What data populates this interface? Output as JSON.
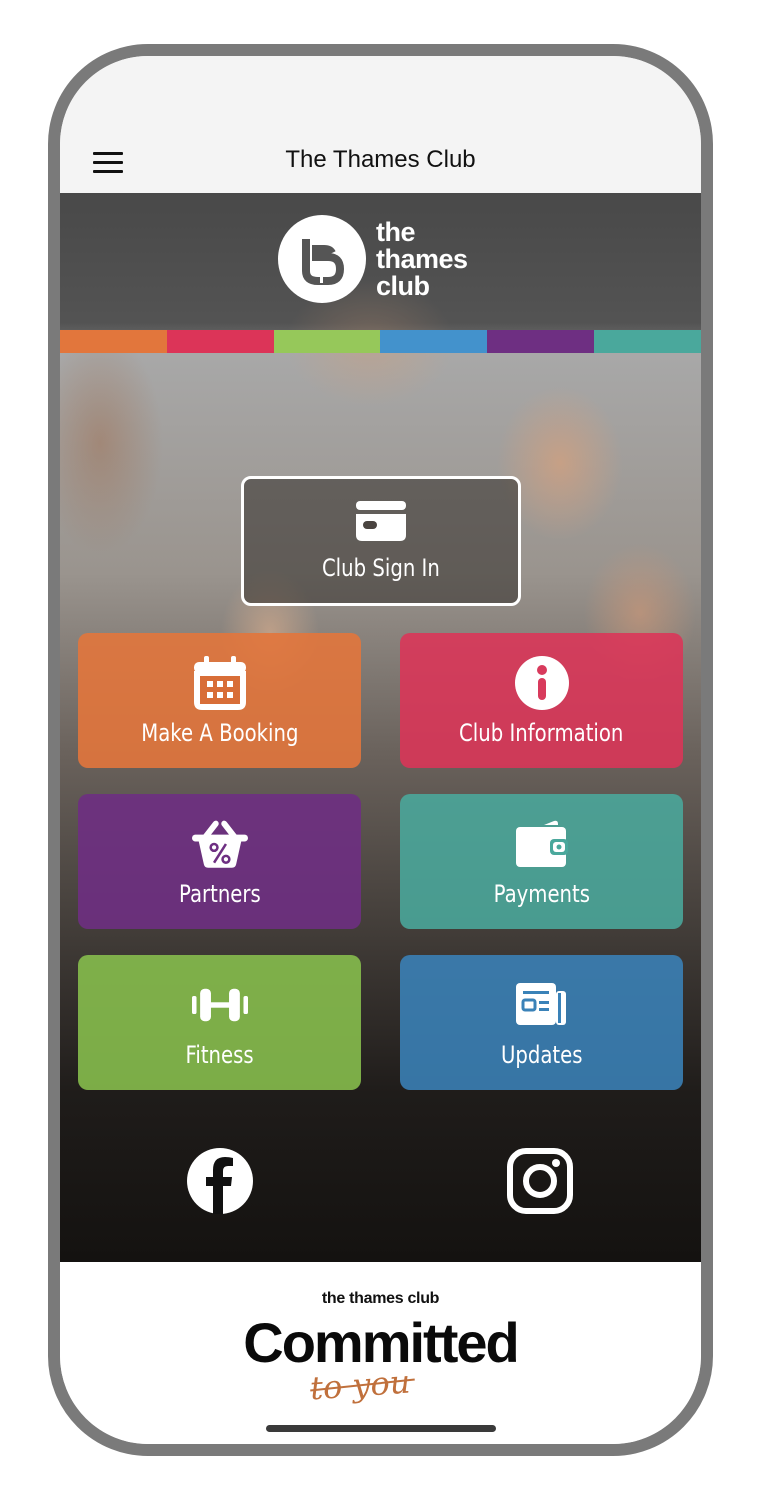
{
  "header": {
    "title": "The Thames Club",
    "menu_icon": "hamburger-icon"
  },
  "hero": {
    "logo": {
      "icon": "thames-club-logo-icon",
      "line1": "the",
      "line2": "thames",
      "line3": "club"
    },
    "brand_colors": [
      "#e2763c",
      "#dc3458",
      "#96c85a",
      "#4392cc",
      "#6e2f82",
      "#4aa89c"
    ]
  },
  "sign_in": {
    "label": "Club Sign In",
    "icon": "card-icon"
  },
  "tiles": [
    {
      "label": "Make A Booking",
      "icon": "calendar-icon",
      "color": "#e2763c"
    },
    {
      "label": "Club Information",
      "icon": "info-icon",
      "color": "#dc3458"
    },
    {
      "label": "Partners",
      "icon": "basket-percent-icon",
      "color": "#6e2f82"
    },
    {
      "label": "Payments",
      "icon": "wallet-icon",
      "color": "#4aa89c"
    },
    {
      "label": "Fitness",
      "icon": "dumbbell-icon",
      "color": "#86bc4c"
    },
    {
      "label": "Updates",
      "icon": "newspaper-icon",
      "color": "#3a82b8"
    }
  ],
  "social": {
    "facebook_icon": "facebook-icon",
    "instagram_icon": "instagram-icon"
  },
  "footer": {
    "small": "the thames club",
    "big": "Committed",
    "script": "to you",
    "script_color": "#c0703c"
  }
}
